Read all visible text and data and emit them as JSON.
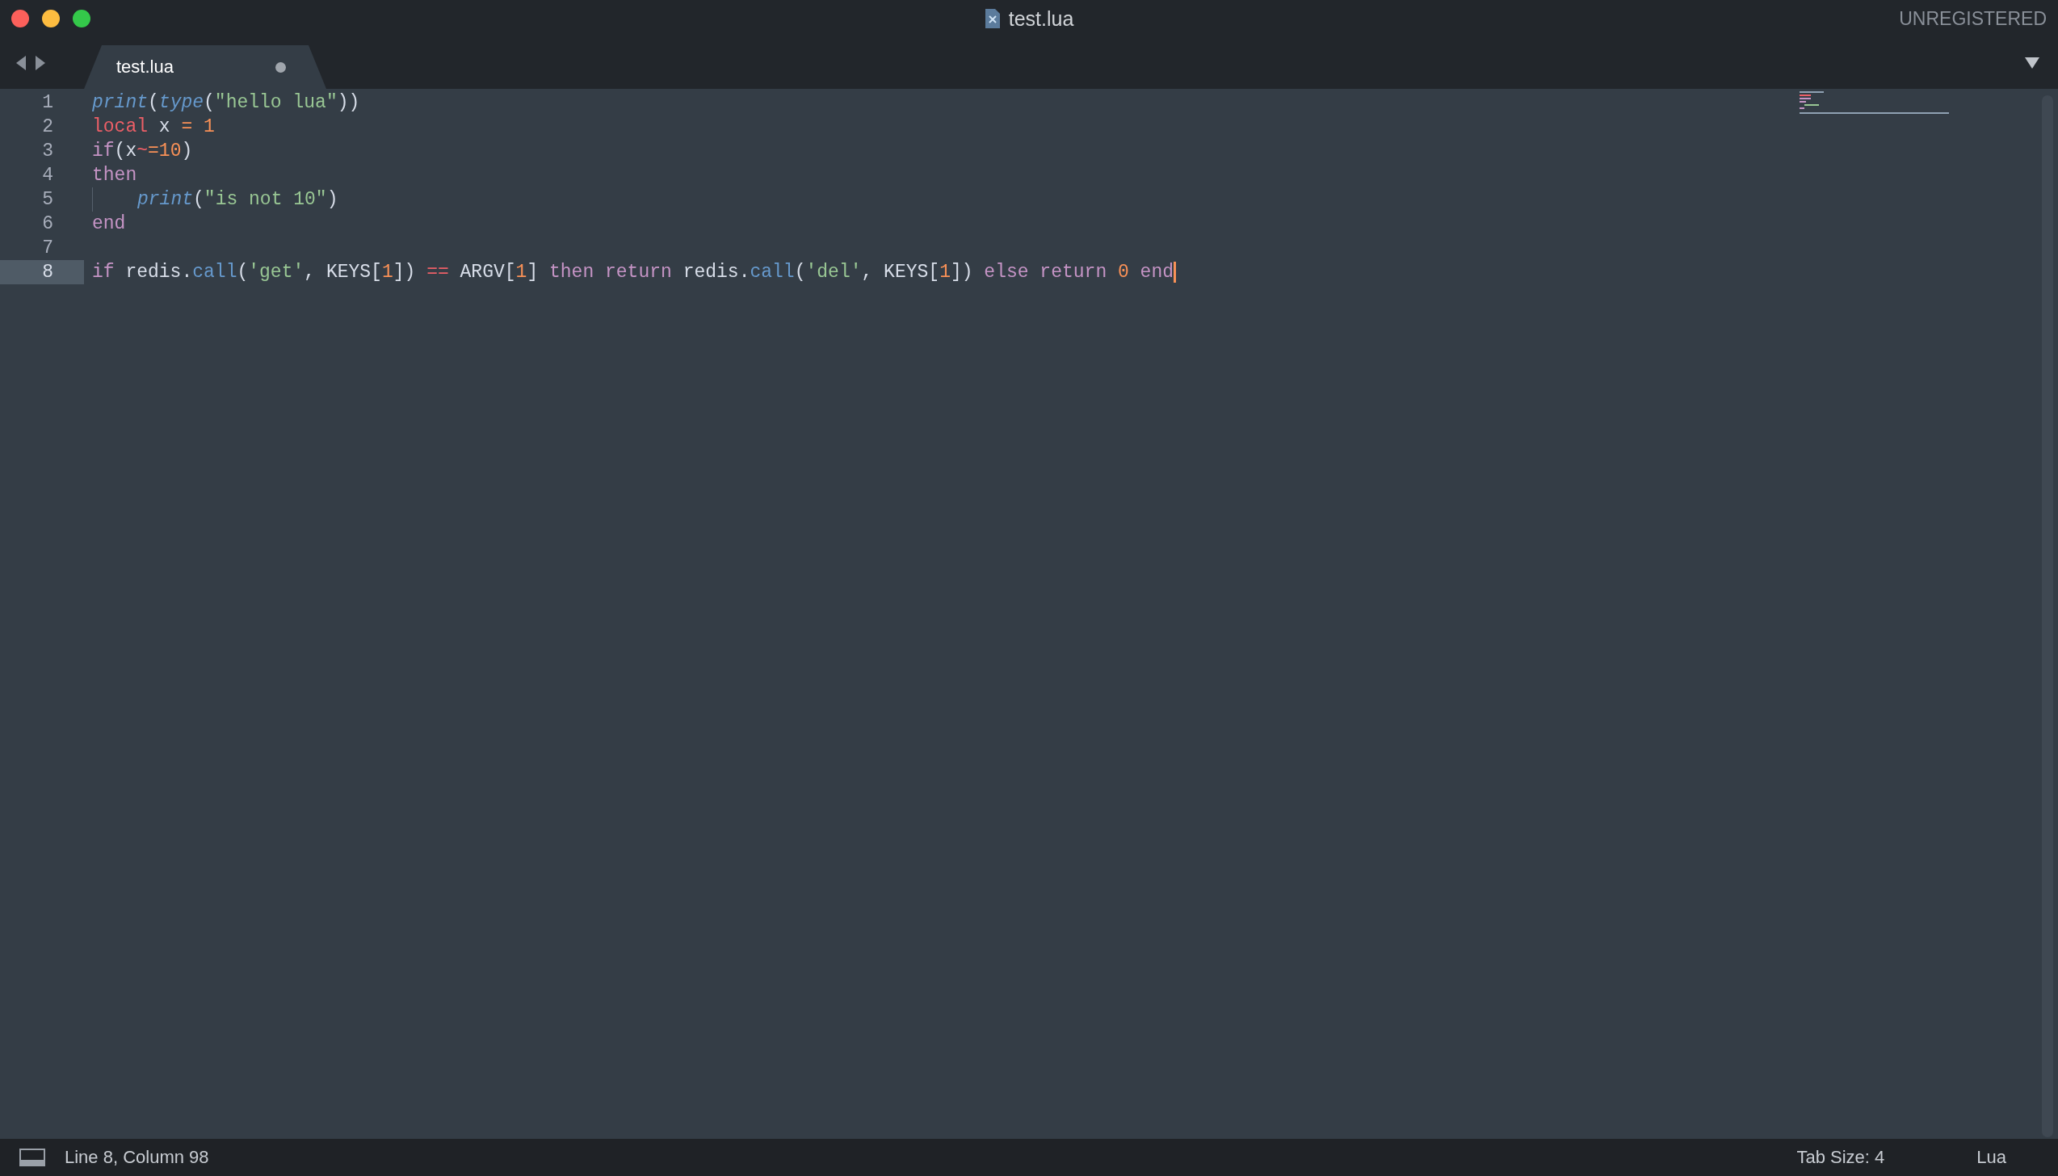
{
  "window": {
    "title": "test.lua",
    "registration": "UNREGISTERED"
  },
  "tabs": [
    {
      "label": "test.lua",
      "selected": true,
      "modified": true
    }
  ],
  "editor": {
    "lines": [
      {
        "number": "1",
        "current": false,
        "indented": false,
        "cursor": false,
        "tokens": [
          {
            "t": "print",
            "kind": "func"
          },
          {
            "t": "(",
            "kind": "plain"
          },
          {
            "t": "type",
            "kind": "func"
          },
          {
            "t": "(",
            "kind": "plain"
          },
          {
            "t": "\"hello lua\"",
            "kind": "str"
          },
          {
            "t": "))",
            "kind": "plain"
          }
        ]
      },
      {
        "number": "2",
        "current": false,
        "indented": false,
        "cursor": false,
        "tokens": [
          {
            "t": "local",
            "kind": "storage"
          },
          {
            "t": " x ",
            "kind": "plain"
          },
          {
            "t": "= ",
            "kind": "op"
          },
          {
            "t": "1",
            "kind": "num"
          }
        ]
      },
      {
        "number": "3",
        "current": false,
        "indented": false,
        "cursor": false,
        "tokens": [
          {
            "t": "if",
            "kind": "kw"
          },
          {
            "t": "(x",
            "kind": "plain"
          },
          {
            "t": "~",
            "kind": "storage"
          },
          {
            "t": "=",
            "kind": "op"
          },
          {
            "t": "10",
            "kind": "num"
          },
          {
            "t": ")",
            "kind": "plain"
          }
        ]
      },
      {
        "number": "4",
        "current": false,
        "indented": false,
        "cursor": false,
        "tokens": [
          {
            "t": "then",
            "kind": "kw"
          }
        ]
      },
      {
        "number": "5",
        "current": false,
        "indented": true,
        "cursor": false,
        "tokens": [
          {
            "t": "print",
            "kind": "func"
          },
          {
            "t": "(",
            "kind": "plain"
          },
          {
            "t": "\"is not 10\"",
            "kind": "str"
          },
          {
            "t": ")",
            "kind": "plain"
          }
        ]
      },
      {
        "number": "6",
        "current": false,
        "indented": false,
        "cursor": false,
        "tokens": [
          {
            "t": "end",
            "kind": "kw"
          }
        ]
      },
      {
        "number": "7",
        "current": false,
        "indented": false,
        "cursor": false
      },
      {
        "number": "8",
        "current": true,
        "indented": false,
        "cursor": true,
        "tokens": [
          {
            "t": "if",
            "kind": "kw"
          },
          {
            "t": " redis.",
            "kind": "plain"
          },
          {
            "t": "call",
            "kind": "prop"
          },
          {
            "t": "(",
            "kind": "plain"
          },
          {
            "t": "'get'",
            "kind": "str"
          },
          {
            "t": ", KEYS[",
            "kind": "plain"
          },
          {
            "t": "1",
            "kind": "num"
          },
          {
            "t": "]) ",
            "kind": "plain"
          },
          {
            "t": "==",
            "kind": "storage"
          },
          {
            "t": " ARGV[",
            "kind": "plain"
          },
          {
            "t": "1",
            "kind": "num"
          },
          {
            "t": "] ",
            "kind": "plain"
          },
          {
            "t": "then return",
            "kind": "kw"
          },
          {
            "t": " redis.",
            "kind": "plain"
          },
          {
            "t": "call",
            "kind": "prop"
          },
          {
            "t": "(",
            "kind": "plain"
          },
          {
            "t": "'del'",
            "kind": "str"
          },
          {
            "t": ", KEYS[",
            "kind": "plain"
          },
          {
            "t": "1",
            "kind": "num"
          },
          {
            "t": "]) ",
            "kind": "plain"
          },
          {
            "t": "else return",
            "kind": "kw"
          },
          {
            "t": " 0 ",
            "kind": "num"
          },
          {
            "t": "end",
            "kind": "kw"
          }
        ]
      }
    ]
  },
  "status_bar": {
    "position": "Line 8, Column 98",
    "tab_size": "Tab Size: 4",
    "syntax": "Lua"
  }
}
